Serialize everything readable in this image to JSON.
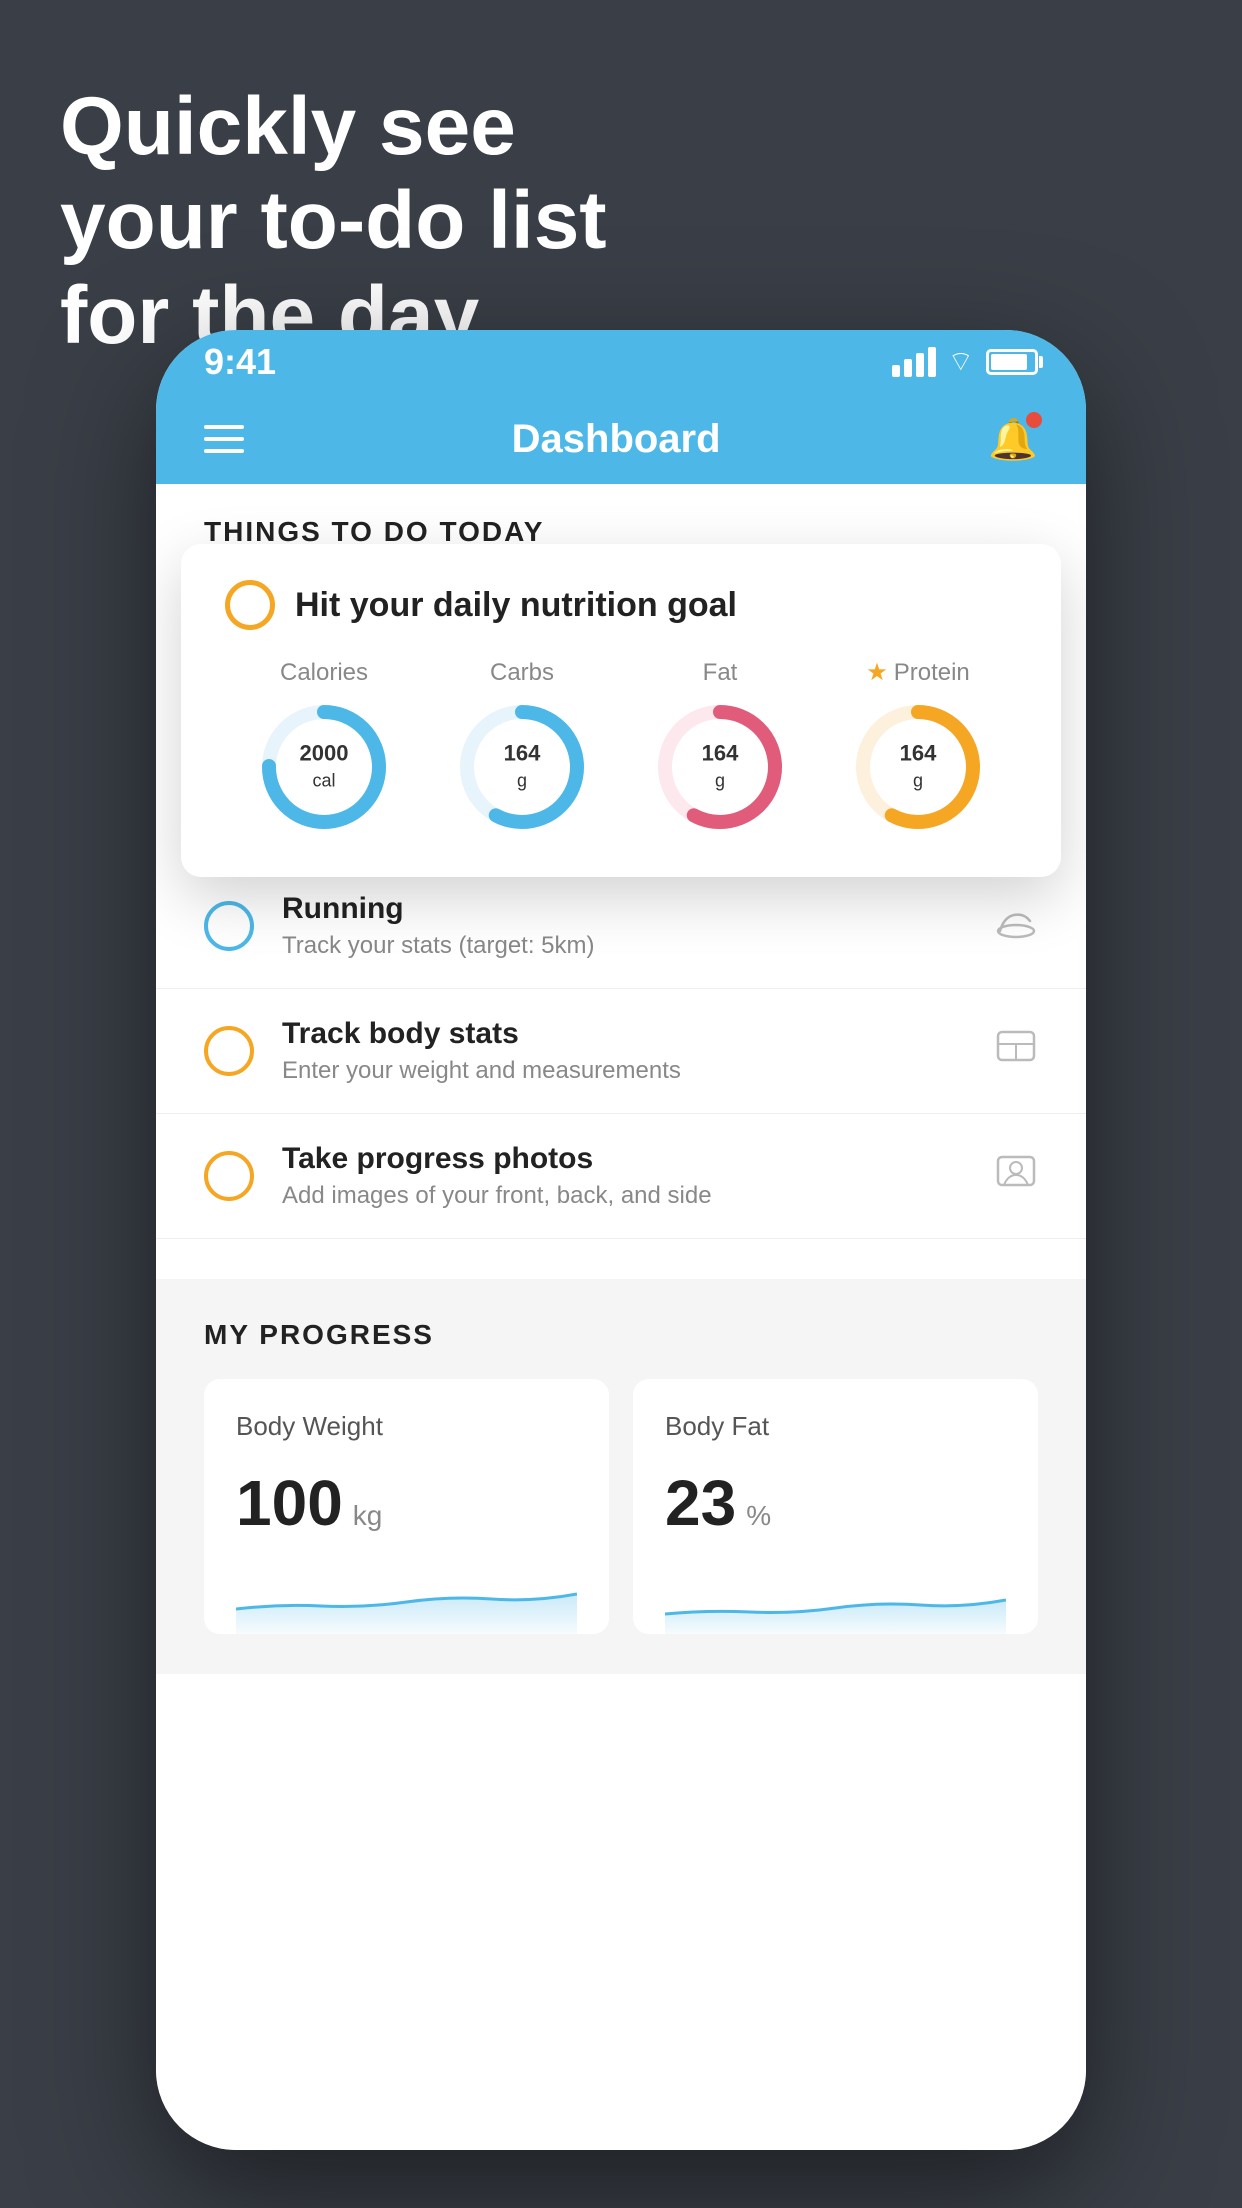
{
  "headline": {
    "line1": "Quickly see",
    "line2": "your to-do list",
    "line3": "for the day."
  },
  "statusBar": {
    "time": "9:41"
  },
  "navBar": {
    "title": "Dashboard"
  },
  "thingsToDoHeader": "THINGS TO DO TODAY",
  "nutritionCard": {
    "title": "Hit your daily nutrition goal",
    "stats": [
      {
        "label": "Calories",
        "value": "2000",
        "unit": "cal",
        "color": "#4db8e8",
        "starred": false
      },
      {
        "label": "Carbs",
        "value": "164",
        "unit": "g",
        "color": "#4db8e8",
        "starred": false
      },
      {
        "label": "Fat",
        "value": "164",
        "unit": "g",
        "color": "#e05c7a",
        "starred": false
      },
      {
        "label": "Protein",
        "value": "164",
        "unit": "g",
        "color": "#f5a623",
        "starred": true
      }
    ]
  },
  "todoItems": [
    {
      "title": "Running",
      "subtitle": "Track your stats (target: 5km)",
      "circleColor": "green",
      "icon": "shoe"
    },
    {
      "title": "Track body stats",
      "subtitle": "Enter your weight and measurements",
      "circleColor": "yellow",
      "icon": "scale"
    },
    {
      "title": "Take progress photos",
      "subtitle": "Add images of your front, back, and side",
      "circleColor": "yellow",
      "icon": "person"
    }
  ],
  "progressSection": {
    "header": "MY PROGRESS",
    "cards": [
      {
        "title": "Body Weight",
        "value": "100",
        "unit": "kg"
      },
      {
        "title": "Body Fat",
        "value": "23",
        "unit": "%"
      }
    ]
  }
}
